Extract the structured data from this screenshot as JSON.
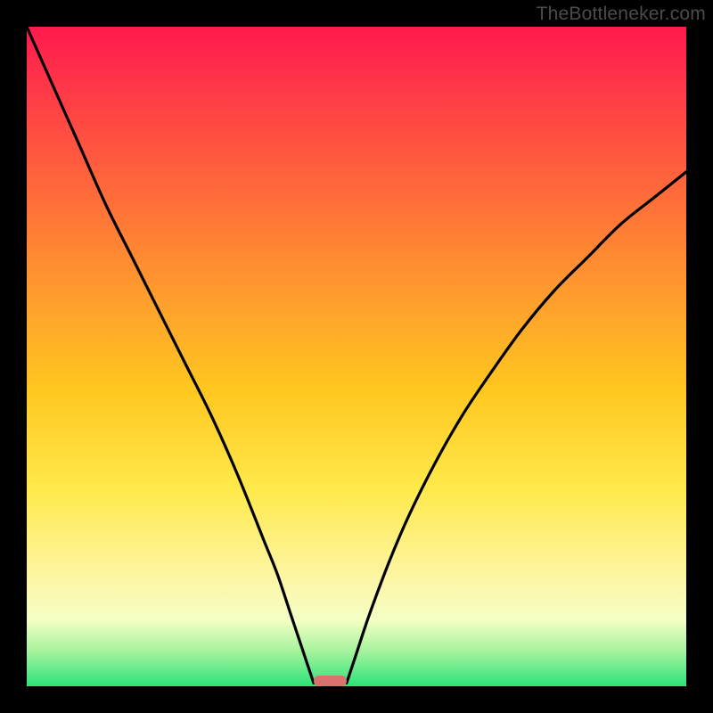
{
  "watermark": "TheBottleneker.com",
  "chart_data": {
    "type": "line",
    "title": "",
    "xlabel": "",
    "ylabel": "",
    "xlim": [
      0,
      100
    ],
    "ylim": [
      0,
      100
    ],
    "grid": false,
    "background_gradient": {
      "direction": "vertical",
      "stops": [
        {
          "pos": 0.0,
          "color": "#ff1a4d"
        },
        {
          "pos": 0.25,
          "color": "#ff6a3a"
        },
        {
          "pos": 0.55,
          "color": "#ffc71f"
        },
        {
          "pos": 0.84,
          "color": "#fdf6a8"
        },
        {
          "pos": 0.95,
          "color": "#9ff29a"
        },
        {
          "pos": 1.0,
          "color": "#2be37b"
        }
      ]
    },
    "series": [
      {
        "name": "left-curve",
        "x": [
          0,
          4,
          8,
          12,
          16,
          20,
          24,
          28,
          32,
          36,
          38,
          40,
          42,
          43.5
        ],
        "y": [
          100,
          91,
          82,
          73,
          65,
          57,
          49,
          41,
          32,
          22,
          17,
          11,
          5,
          0.5
        ]
      },
      {
        "name": "right-curve",
        "x": [
          48.5,
          50,
          52,
          55,
          58,
          62,
          66,
          70,
          75,
          80,
          85,
          90,
          95,
          100
        ],
        "y": [
          0.5,
          5,
          11,
          19,
          26,
          34,
          41,
          47,
          54,
          60,
          65,
          70,
          74,
          78
        ]
      }
    ],
    "marker": {
      "x_center": 46,
      "width_pct": 5,
      "y": 0.8,
      "color": "#d9716f"
    }
  }
}
